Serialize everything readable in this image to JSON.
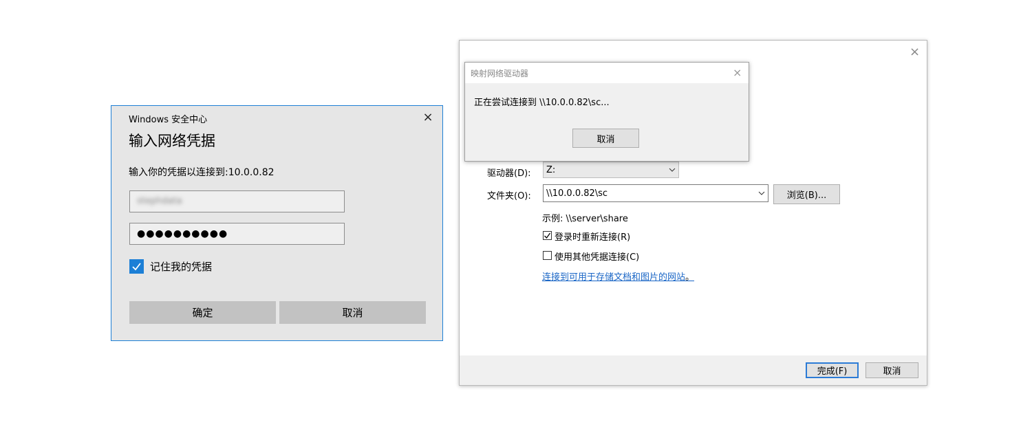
{
  "credential_dialog": {
    "app_title": "Windows 安全中心",
    "heading": "输入网络凭据",
    "prompt": "输入你的凭据以连接到:10.0.0.82",
    "username_value": "stephdata",
    "password_value": "●●●●●●●●●●",
    "remember_label": "记住我的凭据",
    "remember_checked": true,
    "ok_label": "确定",
    "cancel_label": "取消",
    "accent_color": "#1c7fd6",
    "close_icon": "×"
  },
  "map_drive_wizard": {
    "close_icon": "×",
    "drive_label": "驱动器(D):",
    "drive_value": "Z:",
    "folder_label": "文件夹(O):",
    "folder_value": "\\\\10.0.0.82\\sc",
    "browse_label": "浏览(B)...",
    "example_text": "示例: \\\\server\\share",
    "reconnect_label": "登录时重新连接(R)",
    "reconnect_checked": true,
    "other_creds_label": "使用其他凭据连接(C)",
    "other_creds_checked": false,
    "link_text": "连接到可用于存储文档和图片的网站",
    "link_suffix": "。",
    "finish_label": "完成(F)",
    "cancel_label": "取消"
  },
  "progress_dialog": {
    "title": "映射网络驱动器",
    "message": "正在尝试连接到 \\\\10.0.0.82\\sc...",
    "cancel_label": "取消",
    "close_icon": "×"
  }
}
